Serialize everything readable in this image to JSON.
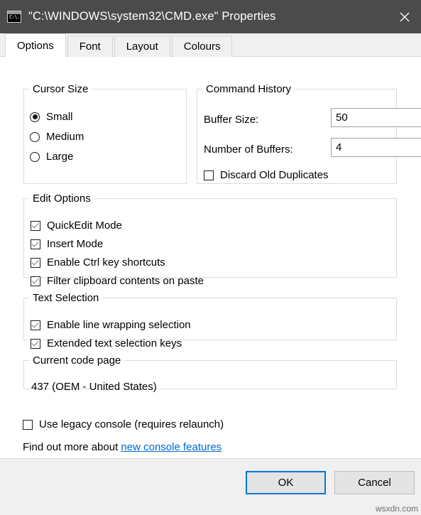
{
  "titlebar": {
    "title": "\"C:\\WINDOWS\\system32\\CMD.exe\" Properties",
    "icon_text_1": "C:\\.",
    "close_label": "Close",
    "background": "#4b4b4b",
    "foreground": "#ffffff"
  },
  "tabs": [
    {
      "label": "Options",
      "active": true
    },
    {
      "label": "Font",
      "active": false
    },
    {
      "label": "Layout",
      "active": false
    },
    {
      "label": "Colours",
      "active": false
    }
  ],
  "cursor_size": {
    "legend": "Cursor Size",
    "options": [
      {
        "label": "Small",
        "selected": true
      },
      {
        "label": "Medium",
        "selected": false
      },
      {
        "label": "Large",
        "selected": false
      }
    ]
  },
  "command_history": {
    "legend": "Command History",
    "buffer_size_label": "Buffer Size:",
    "buffer_size_value": "50",
    "number_of_buffers_label": "Number of Buffers:",
    "number_of_buffers_value": "4",
    "discard_label": "Discard Old Duplicates",
    "discard_checked": false
  },
  "edit_options": {
    "legend": "Edit Options",
    "items": [
      {
        "label": "QuickEdit Mode",
        "checked": true
      },
      {
        "label": "Insert Mode",
        "checked": true
      },
      {
        "label": "Enable Ctrl key shortcuts",
        "checked": true
      },
      {
        "label": "Filter clipboard contents on paste",
        "checked": true
      }
    ]
  },
  "text_selection": {
    "legend": "Text Selection",
    "items": [
      {
        "label": "Enable line wrapping selection",
        "checked": true
      },
      {
        "label": "Extended text selection keys",
        "checked": true
      }
    ]
  },
  "code_page": {
    "legend": "Current code page",
    "value": "437   (OEM - United States)"
  },
  "legacy": {
    "label": "Use legacy console (requires relaunch)",
    "checked": false,
    "find_out_prefix": "Find out more about ",
    "link_text": "new console features",
    "link_color": "#0066cc"
  },
  "footer": {
    "ok_label": "OK",
    "cancel_label": "Cancel",
    "accent": "#0a76d8"
  },
  "watermark": "wsxdn.com"
}
